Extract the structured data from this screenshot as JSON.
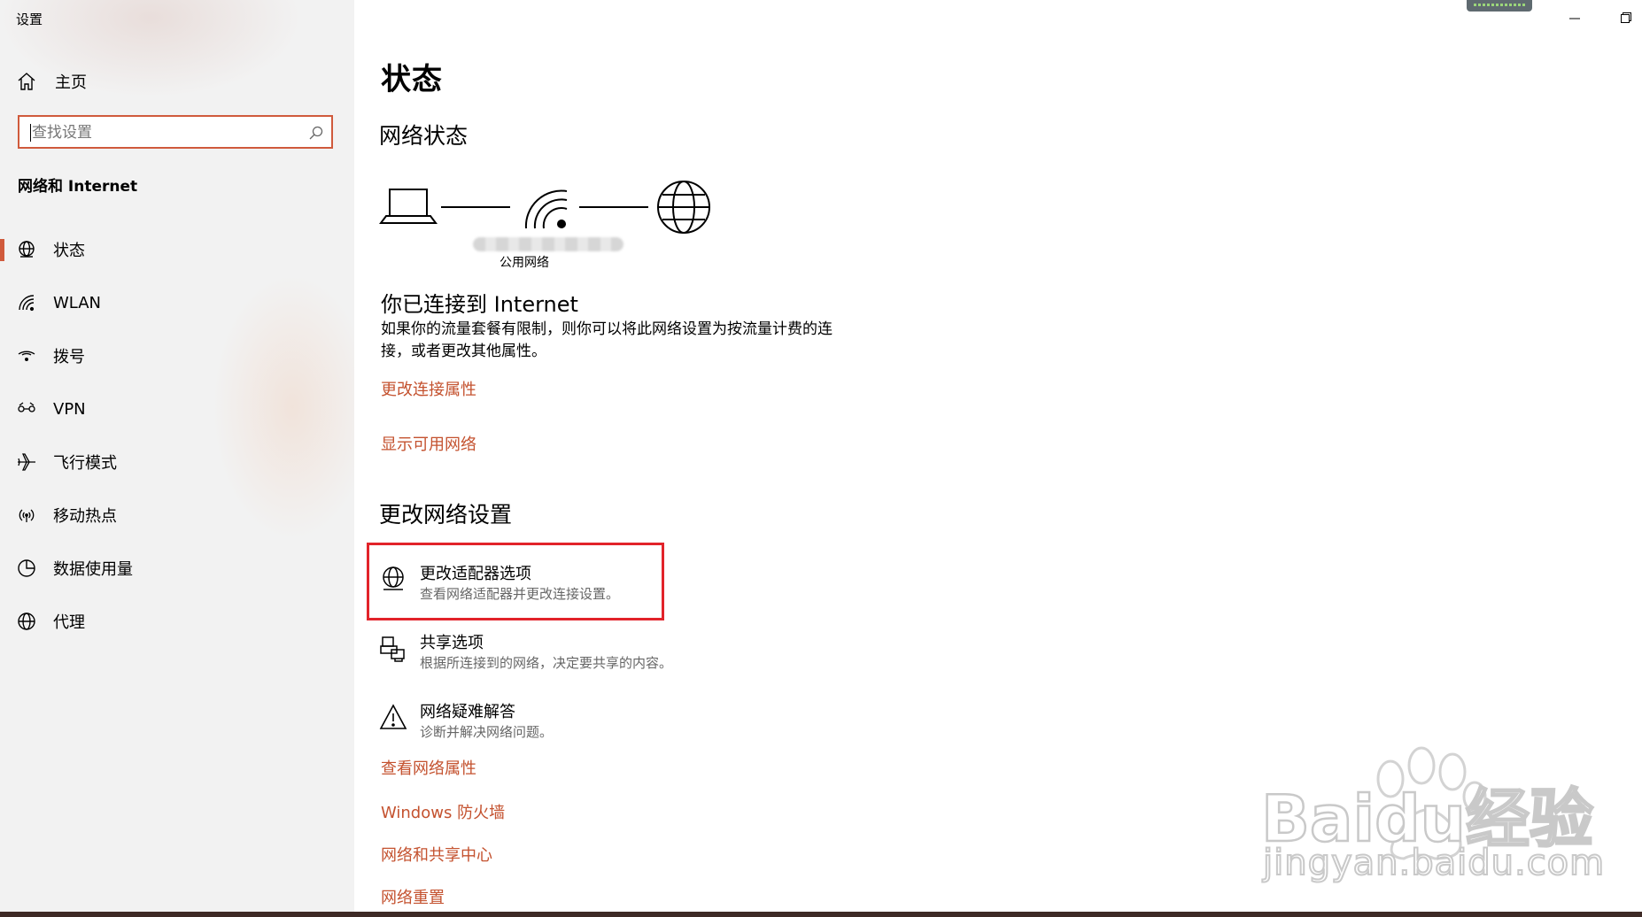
{
  "window": {
    "title": "设置"
  },
  "sidebar": {
    "home_label": "主页",
    "search_placeholder": "查找设置",
    "section_title": "网络和 Internet",
    "items": [
      {
        "label": "状态",
        "icon": "status-globe-icon",
        "selected": true
      },
      {
        "label": "WLAN",
        "icon": "wifi-icon"
      },
      {
        "label": "拨号",
        "icon": "dialup-icon"
      },
      {
        "label": "VPN",
        "icon": "vpn-icon"
      },
      {
        "label": "飞行模式",
        "icon": "airplane-icon"
      },
      {
        "label": "移动热点",
        "icon": "hotspot-icon"
      },
      {
        "label": "数据使用量",
        "icon": "data-usage-icon"
      },
      {
        "label": "代理",
        "icon": "globe-icon"
      }
    ]
  },
  "main": {
    "page_title": "状态",
    "network_status_heading": "网络状态",
    "network_type": "公用网络",
    "connected_title": "你已连接到 Internet",
    "connected_desc": "如果你的流量套餐有限制，则你可以将此网络设置为按流量计费的连接，或者更改其他属性。",
    "link_change_properties": "更改连接属性",
    "link_show_networks": "显示可用网络",
    "change_settings_heading": "更改网络设置",
    "settings": [
      {
        "title": "更改适配器选项",
        "desc": "查看网络适配器并更改连接设置。",
        "icon": "adapter-icon",
        "highlighted": true
      },
      {
        "title": "共享选项",
        "desc": "根据所连接到的网络，决定要共享的内容。",
        "icon": "sharing-icon"
      },
      {
        "title": "网络疑难解答",
        "desc": "诊断并解决网络问题。",
        "icon": "warning-icon"
      }
    ],
    "links": [
      "查看网络属性",
      "Windows 防火墙",
      "网络和共享中心",
      "网络重置"
    ]
  },
  "watermark": {
    "logo": "Baidu经验",
    "url": "jingyan.baidu.com"
  },
  "colors": {
    "accent": "#c4522f",
    "highlight_box": "#e2232a",
    "sidebar_bg": "#f2f2f2"
  }
}
